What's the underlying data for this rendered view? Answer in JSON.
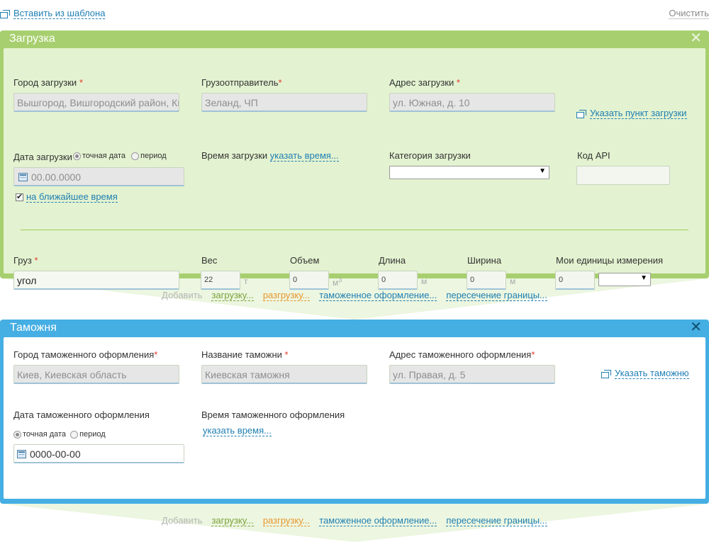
{
  "top": {
    "template_link": "Вставить из шаблона",
    "clear_link": "Очистить"
  },
  "load": {
    "title": "Загрузка",
    "city_label": "Город загрузки",
    "city_value": "Вышгород, Вишгородский район, Киевская область",
    "shipper_label": "Грузоотправитель",
    "shipper_value": "Зеланд, ЧП",
    "address_label": "Адрес загрузки",
    "address_value": "ул. Южная, д. 10",
    "point_link": "Указать пункт загрузки",
    "date_label": "Дата загрузки",
    "radio_exact": "точная дата",
    "radio_period": "период",
    "date_value": "00.00.0000",
    "nearest_label": "на ближайшее время",
    "time_label": "Время загрузки",
    "time_link": "указать время...",
    "category_label": "Категория загрузки",
    "api_label": "Код API",
    "cargo_label": "Груз",
    "cargo_value": "угол",
    "weight_label": "Вес",
    "weight_value": "22",
    "weight_unit": "т",
    "volume_label": "Объем",
    "volume_value": "0",
    "volume_unit": "м",
    "volume_sup": "3",
    "length_label": "Длина",
    "length_value": "0",
    "length_unit": "м",
    "width_label": "Ширина",
    "width_value": "0",
    "width_unit": "м",
    "units_label": "Мои единицы измерения",
    "units_value": "0"
  },
  "add_row": {
    "add_label": "Добавить",
    "loading": "загрузку...",
    "unloading": "разгрузку...",
    "customs": "таможенное оформление...",
    "border": "пересечение границы..."
  },
  "customs": {
    "title": "Таможня",
    "city_label": "Город таможенного оформления",
    "city_value": "Киев, Киевская область",
    "name_label": "Название таможни",
    "name_value": "Киевская таможня",
    "address_label": "Адрес таможенного оформления",
    "address_value": "ул. Правая, д. 5",
    "point_link": "Указать таможню",
    "date_label": "Дата таможенного оформления",
    "radio_exact": "точная дата",
    "radio_period": "период",
    "date_value": "0000-00-00",
    "time_label": "Время таможенного оформления",
    "time_link": "указать время..."
  },
  "colors": {
    "load_header": "#a7cf6f",
    "load_body": "#e3f2d0",
    "customs_header": "#45aee3",
    "link": "#1f7fb3",
    "required": "#e23a2a"
  }
}
